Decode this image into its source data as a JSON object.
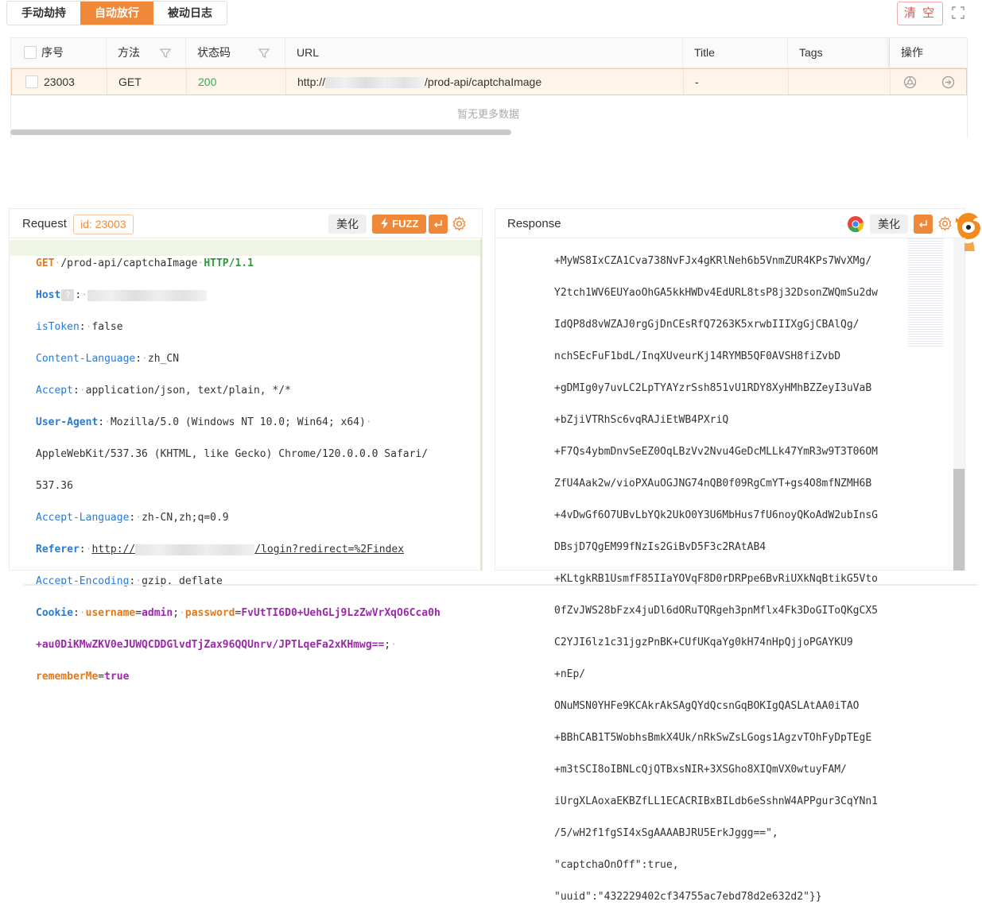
{
  "tabs": [
    {
      "label": "手动劫持",
      "active": false
    },
    {
      "label": "自动放行",
      "active": true
    },
    {
      "label": "被动日志",
      "active": false
    }
  ],
  "clear_label": "清 空",
  "table": {
    "headers": {
      "index": "序号",
      "method": "方法",
      "status": "状态码",
      "url": "URL",
      "title": "Title",
      "tags": "Tags",
      "actions": "操作"
    },
    "row": {
      "index": "23003",
      "method": "GET",
      "status": "200",
      "url_prefix": "http://",
      "url_suffix": "/prod-api/captchaImage",
      "title": "-",
      "tags": ""
    },
    "empty_text": "暂无更多数据"
  },
  "request": {
    "title": "Request",
    "id_label": "id: 23003",
    "beautify_label": "美化",
    "fuzz_label": "FUZZ",
    "lines": {
      "l1_method": "GET",
      "l1_path": "/prod-api/captchaImage",
      "l1_version": "HTTP/1.1",
      "host_key": "Host",
      "istoken_key": "isToken",
      "istoken_val": "false",
      "cl_key": "Content-Language",
      "cl_val": "zh_CN",
      "accept_key": "Accept",
      "accept_val": "application/json, text/plain, */*",
      "ua_key": "User-Agent",
      "ua_val1": "Mozilla/5.0 (Windows NT 10.0; Win64; x64)",
      "ua_val2": "AppleWebKit/537.36 (KHTML, like Gecko) Chrome/120.0.0.0 Safari/",
      "ua_val3": "537.36",
      "al_key": "Accept-Language",
      "al_val": "zh-CN,zh;q=0.9",
      "ref_key": "Referer",
      "ref_prefix": "http://",
      "ref_suffix": "/login?redirect=%2Findex",
      "ae_key": "Accept-Encoding",
      "ae_val": "gzip, deflate",
      "cookie_key": "Cookie",
      "ck_user_k": "username",
      "ck_user_v": "admin",
      "ck_pass_k": "password",
      "ck_pass_v1": "FvUtTI6D0+UehGLj9LzZwVrXqO6Cca0h",
      "ck_pass_v2": "+au0DiKMwZKV0eJUWQCDDGlvdTjZax96QQUnrv/JPTLqeFa2xKHmwg==",
      "ck_rm_k": "rememberMe",
      "ck_rm_v": "true"
    }
  },
  "response": {
    "title": "Response",
    "beautify_label": "美化",
    "lines": [
      "+MyWS8IxCZA1Cva738NvFJx4gKRlNeh6b5VnmZUR4KPs7WvXMg/",
      "Y2tch1WV6EUYaoOhGA5kkHWDv4EdURL8tsP8j32DsonZWQmSu2dw",
      "IdQP8d8vWZAJ0rgGjDnCEsRfQ7263K5xrwbIIIXgGjCBAlQg/",
      "nchSEcFuF1bdL/InqXUveurKj14RYMB5QF0AVSH8fiZvbD",
      "+gDMIg0y7uvLC2LpTYAYzrSsh851vU1RDY8XyHMhBZZeyI3uVaB",
      "+bZjiVTRhSc6vqRAJiEtWB4PXriQ",
      "+F7Qs4ybmDnvSeEZ0OqLBzVv2Nvu4GeDcMLLk47YmR3w9T3T06OM",
      "ZfU4Aak2w/vioPXAuOGJNG74nQB0f09RgCmYT+gs4O8mfNZMH6B",
      "+4vDwGf6O7UBvLbYQk2UkO0Y3U6MbHus7fU6noyQKoAdW2ubInsG",
      "DBsjD7QgEM99fNzIs2GiBvD5F3c2RAtAB4",
      "+KLtgkRB1UsmfF85IIaYOVqF8D0rDRPpe6BvRiUXkNqBtikG5Vto",
      "0fZvJWS28bFzx4juDl6dORuTQRgeh3pnMflx4Fk3DoGIToQKgCX5",
      "C2YJI6lz1c31jgzPnBK+CUfUKqaYg0kH74nHpQjjoPGAYKU9",
      "+nEp/",
      "ONuMSN0YHFe9KCAkrAkSAgQYdQcsnGqBOKIgQASLAtAA0iTAO",
      "+BBhCAB1T5WobhsBmkX4Uk/nRkSwZsLGogs1AgzvTOhFyDpTEgE",
      "+m3tSCI8oIBNLcQjQTBxsNIR+3XSGho8XIQmVX0wtuyFAM/",
      "iUrgXLAoxaEKBZfLL1ECACRIBxBILdb6eSshnW4APPgur3CqYNn1",
      "/5/wH2f1fgSI4xSgAAAABJRU5ErkJggg==\",",
      "\"captchaOnOff\":true,",
      "\"uuid\":\"432229402cf34755ac7ebd78d2e632d2\"}}"
    ]
  },
  "colors": {
    "accent": "#f0883a",
    "status_ok": "#3aa856",
    "danger": "#e05050"
  },
  "icons": [
    "filter-icon",
    "chrome-icon",
    "settings-icon",
    "enter-icon",
    "lightning-icon",
    "expand-icon",
    "arrow-circle-icon",
    "browser-icon",
    "mascot-icon"
  ]
}
